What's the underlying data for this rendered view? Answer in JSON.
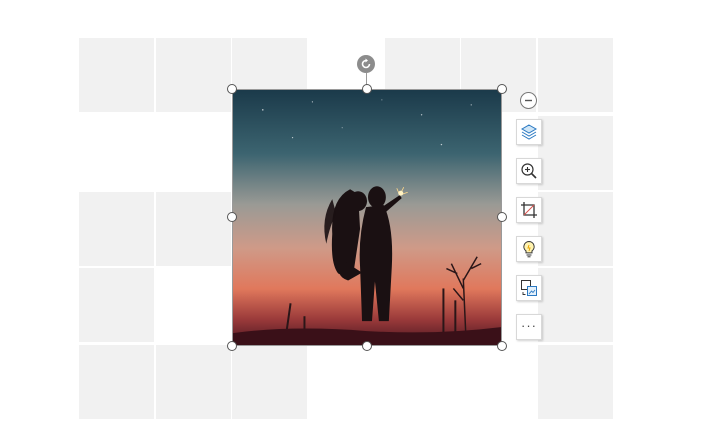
{
  "canvas": {
    "grid_color": "#f1f1f1",
    "background": "#ffffff"
  },
  "selected_image": {
    "description_icon": "photo-couple-silhouette-icon",
    "sky_top": "#1d3f50",
    "horizon": "#e08060",
    "ground": "#5a1b25"
  },
  "toolbar": {
    "collapse_icon": "minus-circle-icon",
    "items": [
      {
        "icon": "layers-icon"
      },
      {
        "icon": "zoom-in-icon"
      },
      {
        "icon": "crop-icon"
      },
      {
        "icon": "lightbulb-icon"
      },
      {
        "icon": "replace-image-icon"
      },
      {
        "icon": "more-icon",
        "label": "···"
      }
    ]
  }
}
